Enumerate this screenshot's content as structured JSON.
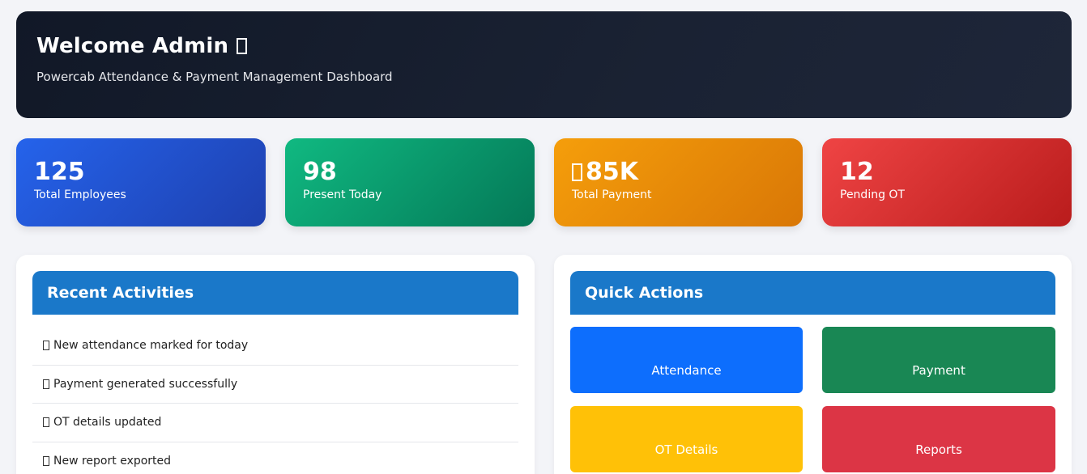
{
  "header": {
    "title": "Welcome Admin",
    "subtitle": "Powercab Attendance & Payment Management Dashboard"
  },
  "stats": [
    {
      "value": "125",
      "label": "Total Employees",
      "color": "#2563eb"
    },
    {
      "value": "98",
      "label": "Present Today",
      "color": "#10b981"
    },
    {
      "value": "85K",
      "label": "Total Payment",
      "color": "#f59e0b"
    },
    {
      "value": "12",
      "label": "Pending OT",
      "color": "#ef4444"
    }
  ],
  "recent_activities": {
    "title": "Recent Activities",
    "items": [
      "New attendance marked for today",
      "Payment generated successfully",
      "OT details updated",
      "New report exported"
    ]
  },
  "quick_actions": {
    "title": "Quick Actions",
    "buttons": [
      {
        "label": "Attendance",
        "color": "#0d6efd"
      },
      {
        "label": "Payment",
        "color": "#198754"
      },
      {
        "label": "OT Details",
        "color": "#ffc107"
      },
      {
        "label": "Reports",
        "color": "#dc3545"
      }
    ]
  },
  "icons": {
    "welcome": "missing-glyph-icon",
    "currency": "missing-glyph-icon",
    "activity": "missing-glyph-icon"
  }
}
